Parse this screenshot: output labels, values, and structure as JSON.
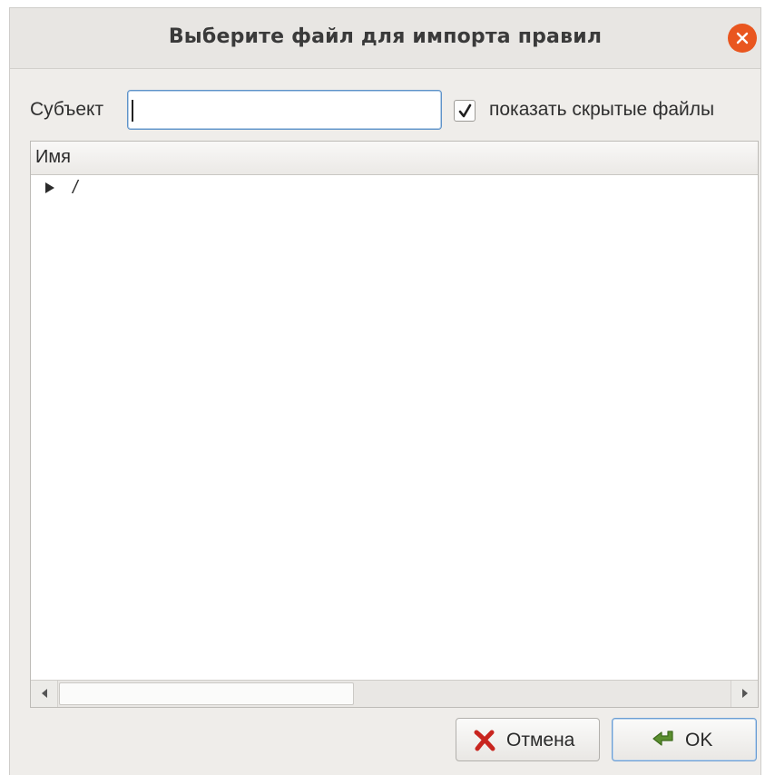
{
  "dialog": {
    "title": "Выберите файл для импорта правил",
    "close_icon": "close-icon",
    "accent": "#e9561f"
  },
  "subject": {
    "label": "Субъект",
    "value": ""
  },
  "show_hidden": {
    "label": "показать скрытые файлы",
    "checked": true
  },
  "tree": {
    "columns": [
      "Имя"
    ],
    "rows": [
      {
        "label": "/",
        "expander": "collapsed-triangle-icon"
      }
    ]
  },
  "buttons": {
    "cancel_label": "Отмена",
    "cancel_icon": "red-x-icon",
    "ok_label": "OK",
    "ok_icon": "green-arrow-icon"
  }
}
